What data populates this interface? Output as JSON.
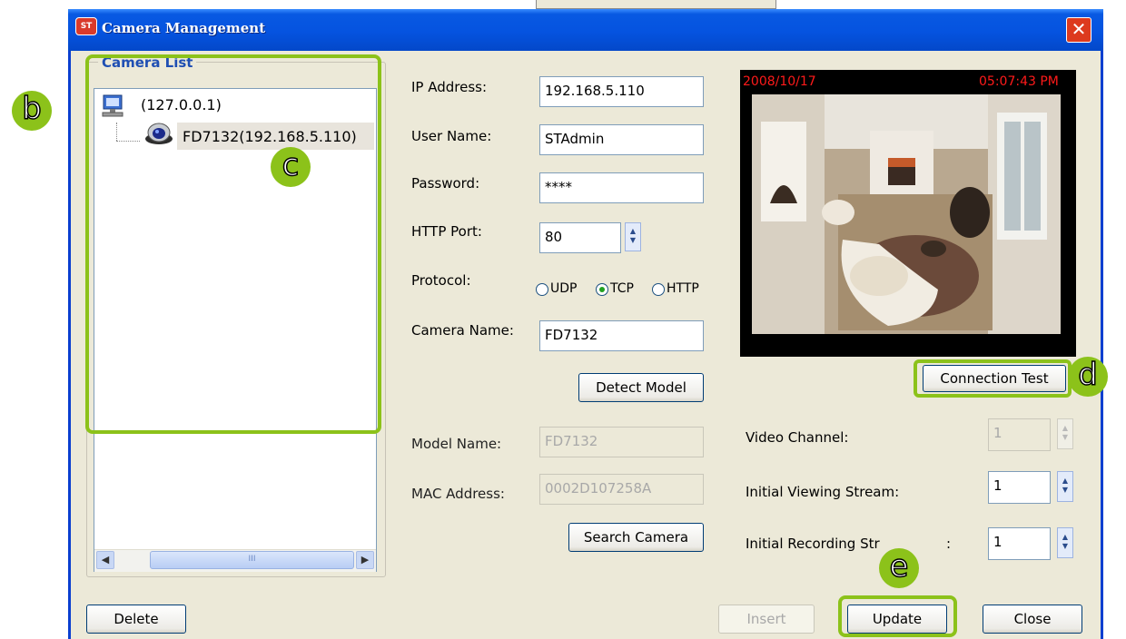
{
  "window": {
    "title": "Camera Management",
    "app_icon_label": "ST"
  },
  "camera_list": {
    "heading": "Camera List",
    "host": "(127.0.0.1)",
    "camera": "FD7132(192.168.5.110)",
    "scroll_thumb_grip": "III"
  },
  "form": {
    "ip_label": "IP Address:",
    "ip_value": "192.168.5.110",
    "user_label": "User Name:",
    "user_value": "STAdmin",
    "password_label": "Password:",
    "password_value": "****",
    "port_label": "HTTP Port:",
    "port_value": "80",
    "protocol_label": "Protocol:",
    "protocol_options": [
      "UDP",
      "TCP",
      "HTTP"
    ],
    "protocol_selected": "TCP",
    "camera_name_label": "Camera Name:",
    "camera_name_value": "FD7132",
    "detect_model_button": "Detect Model",
    "model_name_label": "Model Name:",
    "model_name_value": "FD7132",
    "mac_label": "MAC Address:",
    "mac_value": "0002D107258A",
    "search_camera_button": "Search Camera"
  },
  "preview": {
    "date": "2008/10/17",
    "time": "05:07:43 PM"
  },
  "right": {
    "connection_test_button": "Connection Test",
    "video_channel_label": "Video Channel:",
    "video_channel_value": "1",
    "initial_viewing_label": "Initial Viewing Stream:",
    "initial_viewing_value": "1",
    "initial_recording_label": "Initial Recording Str",
    "initial_recording_tail": ":",
    "initial_recording_value": "1"
  },
  "footer": {
    "delete_button": "Delete",
    "insert_button": "Insert",
    "update_button": "Update",
    "close_button": "Close"
  },
  "callouts": {
    "b": "b",
    "c": "c",
    "d": "d",
    "e": "e"
  },
  "colors": {
    "titlebar": "#0553e0",
    "callout_green": "#8cc21a",
    "dialog_bg": "#ece9d8",
    "overlay_red": "#ff1a1a"
  }
}
